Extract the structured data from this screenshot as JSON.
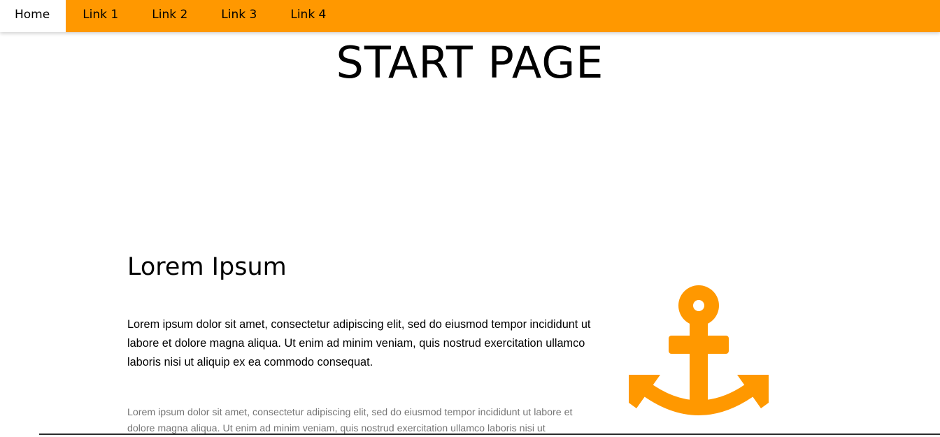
{
  "nav": {
    "items": [
      {
        "label": "Home",
        "active": true
      },
      {
        "label": "Link 1",
        "active": false
      },
      {
        "label": "Link 2",
        "active": false
      },
      {
        "label": "Link 3",
        "active": false
      },
      {
        "label": "Link 4",
        "active": false
      }
    ]
  },
  "header": {
    "title": "START PAGE"
  },
  "content": {
    "heading": "Lorem Ipsum",
    "lead": "Lorem ipsum dolor sit amet, consectetur adipiscing elit, sed do eiusmod tempor incididunt ut labore et dolore magna aliqua. Ut enim ad minim veniam, quis nostrud exercitation ullamco laboris nisi ut aliquip ex ea commodo consequat.",
    "body": "Lorem ipsum dolor sit amet, consectetur adipiscing elit, sed do eiusmod tempor incididunt ut labore et dolore magna aliqua. Ut enim ad minim veniam, quis nostrud exercitation ullamco laboris nisi ut"
  },
  "icons": {
    "illustration": "anchor-icon"
  },
  "colors": {
    "accent": "#ff9800",
    "text": "#000000",
    "muted": "#757575",
    "background": "#ffffff"
  }
}
